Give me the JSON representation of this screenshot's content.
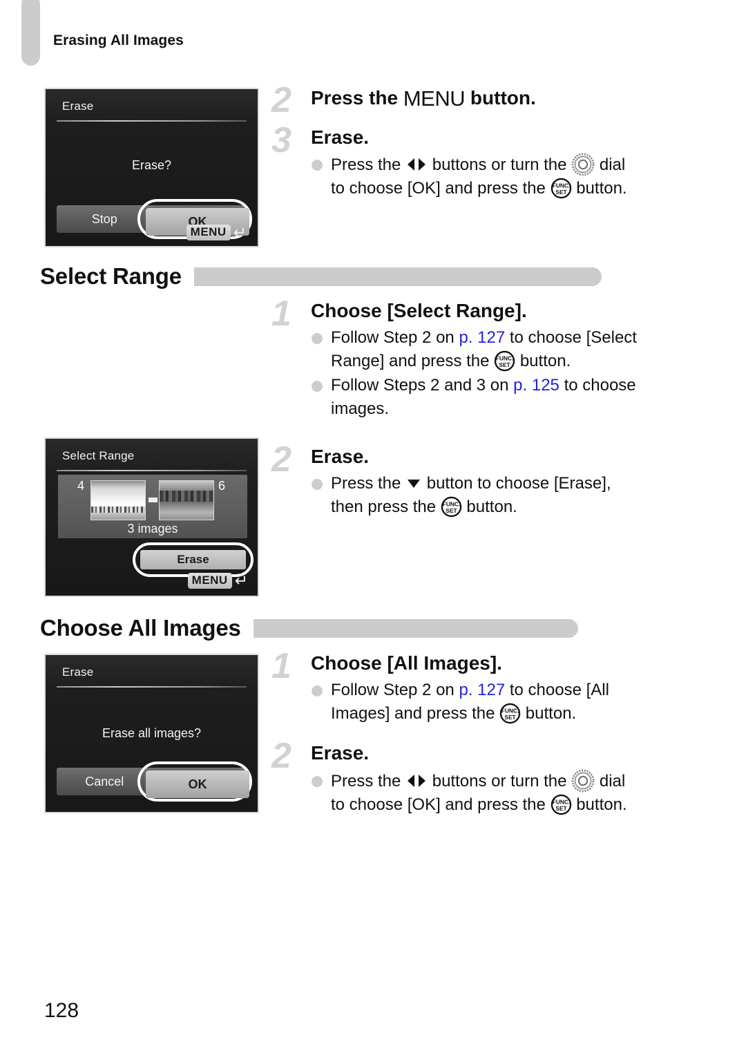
{
  "page": {
    "running_header": "Erasing All Images",
    "folio": "128",
    "link_color": "#2222dd",
    "accent_gray": "#cccccc"
  },
  "screens": [
    {
      "name": "erase-confirm",
      "title": "Erase",
      "prompt": "Erase?",
      "options": [
        "Stop",
        "OK"
      ],
      "selected_option": "OK",
      "menu_hint": "MENU",
      "return_icon": "return-arrow-icon"
    },
    {
      "name": "select-range",
      "title": "Select Range",
      "start_index": "4",
      "end_index": "6",
      "count_label": "3 images",
      "action_button": "Erase",
      "menu_hint": "MENU",
      "return_icon": "return-arrow-icon",
      "thumbnails": [
        {
          "label": "4",
          "art": "city-skyline-photo"
        },
        {
          "label": "6",
          "art": "riverside-photo"
        }
      ]
    },
    {
      "name": "erase-all-confirm",
      "title": "Erase",
      "prompt": "Erase all images?",
      "options": [
        "Cancel",
        "OK"
      ],
      "selected_option": "OK"
    }
  ],
  "blocks": [
    {
      "id": "erase-all-steps",
      "steps": [
        {
          "num": "2",
          "title_parts": [
            "Press the ",
            "MENU",
            " button."
          ],
          "title_plain": "Press the MENU button.",
          "bullets": []
        },
        {
          "num": "3",
          "title_plain": "Erase.",
          "bullets": [
            "Press the ◀▶ buttons or turn the ○ dial to choose [OK] and press the FUNC./SET button."
          ]
        }
      ]
    },
    {
      "id": "select-range-steps",
      "steps": [
        {
          "num": "1",
          "title_plain": "Choose [Select Range].",
          "bullets": [
            "Follow Step 2 on p. 127 to choose [Select Range] and press the FUNC./SET button.",
            "Follow Steps 2 and 3 on p. 125 to choose images."
          ]
        },
        {
          "num": "2",
          "title_plain": "Erase.",
          "bullets": [
            "Press the ▼ button to choose [Erase], then press the FUNC./SET button."
          ]
        }
      ]
    },
    {
      "id": "all-images-steps",
      "steps": [
        {
          "num": "1",
          "title_plain": "Choose [All Images].",
          "bullets": [
            "Follow Step 2 on p. 127 to choose [All Images] and press the FUNC./SET button."
          ]
        },
        {
          "num": "2",
          "title_plain": "Erase.",
          "bullets": [
            "Press the ◀▶ buttons or turn the ○ dial to choose [OK] and press the FUNC./SET button."
          ]
        }
      ]
    }
  ],
  "text": {
    "s2_title_pre": "Press the ",
    "s2_menu": "MENU",
    "s2_title_post": " button.",
    "erase_title": "Erase.",
    "press_the": "Press the ",
    "buttons_or_turn_the": " buttons or turn the ",
    "dial_to_choose_ok": " dial",
    "to_choose_ok_and_press_the": "to choose [OK] and press the ",
    "button_period": " button.",
    "choose_select_range": "Choose [Select Range].",
    "follow_step2_on": "Follow Step 2 on ",
    "p127": "p. 127",
    "to_choose_select": " to choose [Select",
    "range_and_press_the": "Range] and press the ",
    "follow_steps_2_and_3_on": "Follow Steps 2 and 3 on ",
    "p125": "p. 125",
    "to_choose": " to choose",
    "images_word": "images.",
    "press_the_down": "Press the ",
    "button_to_choose_erase": " button to choose [Erase],",
    "then_press_the": "then press the ",
    "choose_all_images": "Choose [All Images].",
    "to_choose_all": " to choose [All",
    "images_and_press_the": "Images] and press the "
  },
  "sections": [
    {
      "id": "select-range",
      "heading": "Select Range"
    },
    {
      "id": "choose-all-images",
      "heading": "Choose All Images"
    }
  ]
}
